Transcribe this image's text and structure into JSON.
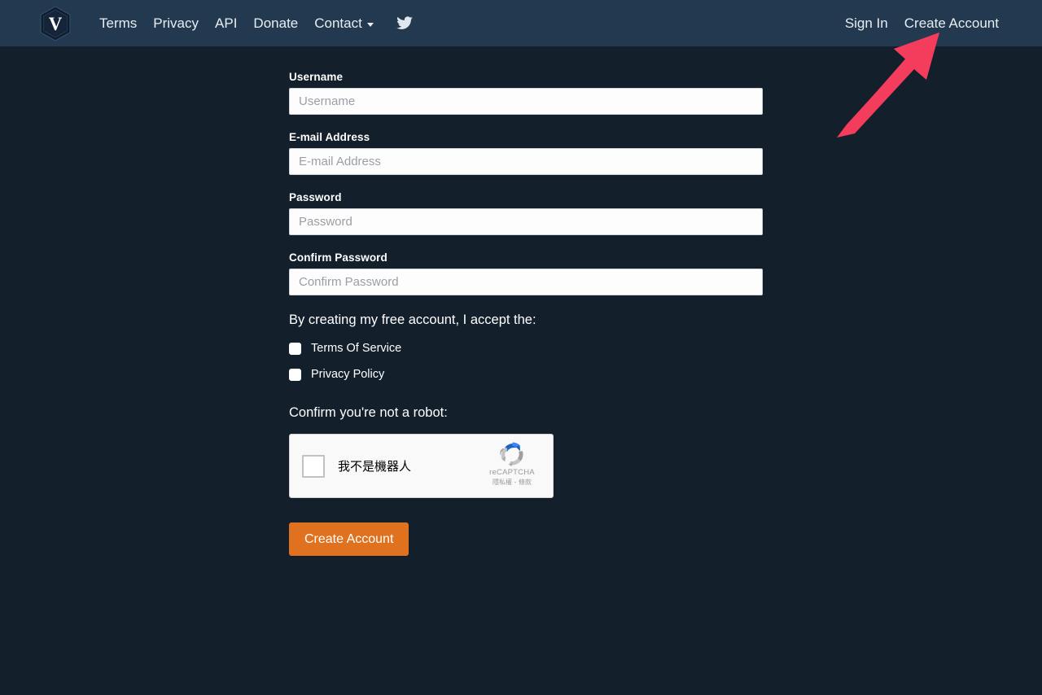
{
  "colors": {
    "navbar_bg": "#22394F",
    "page_bg": "#131F2B",
    "accent_orange": "#E0721F",
    "annotation_red": "#F43C5C",
    "input_bg": "#FDFDFD",
    "recaptcha_bg": "#F9F9F9"
  },
  "navbar": {
    "brand_letter": "V",
    "brand_icon": "hexagon-v-logo",
    "left_links": [
      {
        "label": "Terms",
        "name": "nav-link-terms"
      },
      {
        "label": "Privacy",
        "name": "nav-link-privacy"
      },
      {
        "label": "API",
        "name": "nav-link-api"
      },
      {
        "label": "Donate",
        "name": "nav-link-donate"
      }
    ],
    "dropdown": {
      "label": "Contact",
      "caret_icon": "chevron-down-icon"
    },
    "social": {
      "icon": "twitter-icon"
    },
    "right_links": [
      {
        "label": "Sign In",
        "name": "nav-link-sign-in"
      },
      {
        "label": "Create Account",
        "name": "nav-link-create-account"
      }
    ]
  },
  "form": {
    "fields": [
      {
        "label": "Username",
        "placeholder": "Username",
        "value": "",
        "type": "text"
      },
      {
        "label": "E-mail Address",
        "placeholder": "E-mail Address",
        "value": "",
        "type": "text"
      },
      {
        "label": "Password",
        "placeholder": "Password",
        "value": "",
        "type": "password"
      },
      {
        "label": "Confirm Password",
        "placeholder": "Confirm Password",
        "value": "",
        "type": "password"
      }
    ],
    "accept_heading": "By creating my free account, I accept the:",
    "checkboxes": [
      {
        "label": "Terms Of Service",
        "checked": false
      },
      {
        "label": "Privacy Policy",
        "checked": false
      }
    ],
    "robot_heading": "Confirm you're not a robot:",
    "recaptcha": {
      "checkbox_label": "我不是機器人",
      "brand_name": "reCAPTCHA",
      "legal_text": "隱私權 - 條款",
      "logo_icon": "recaptcha-logo-icon",
      "checked": false
    },
    "submit_label": "Create Account"
  },
  "annotation": {
    "arrow_icon": "arrow-pointing-up-right",
    "target": "Create Account"
  }
}
